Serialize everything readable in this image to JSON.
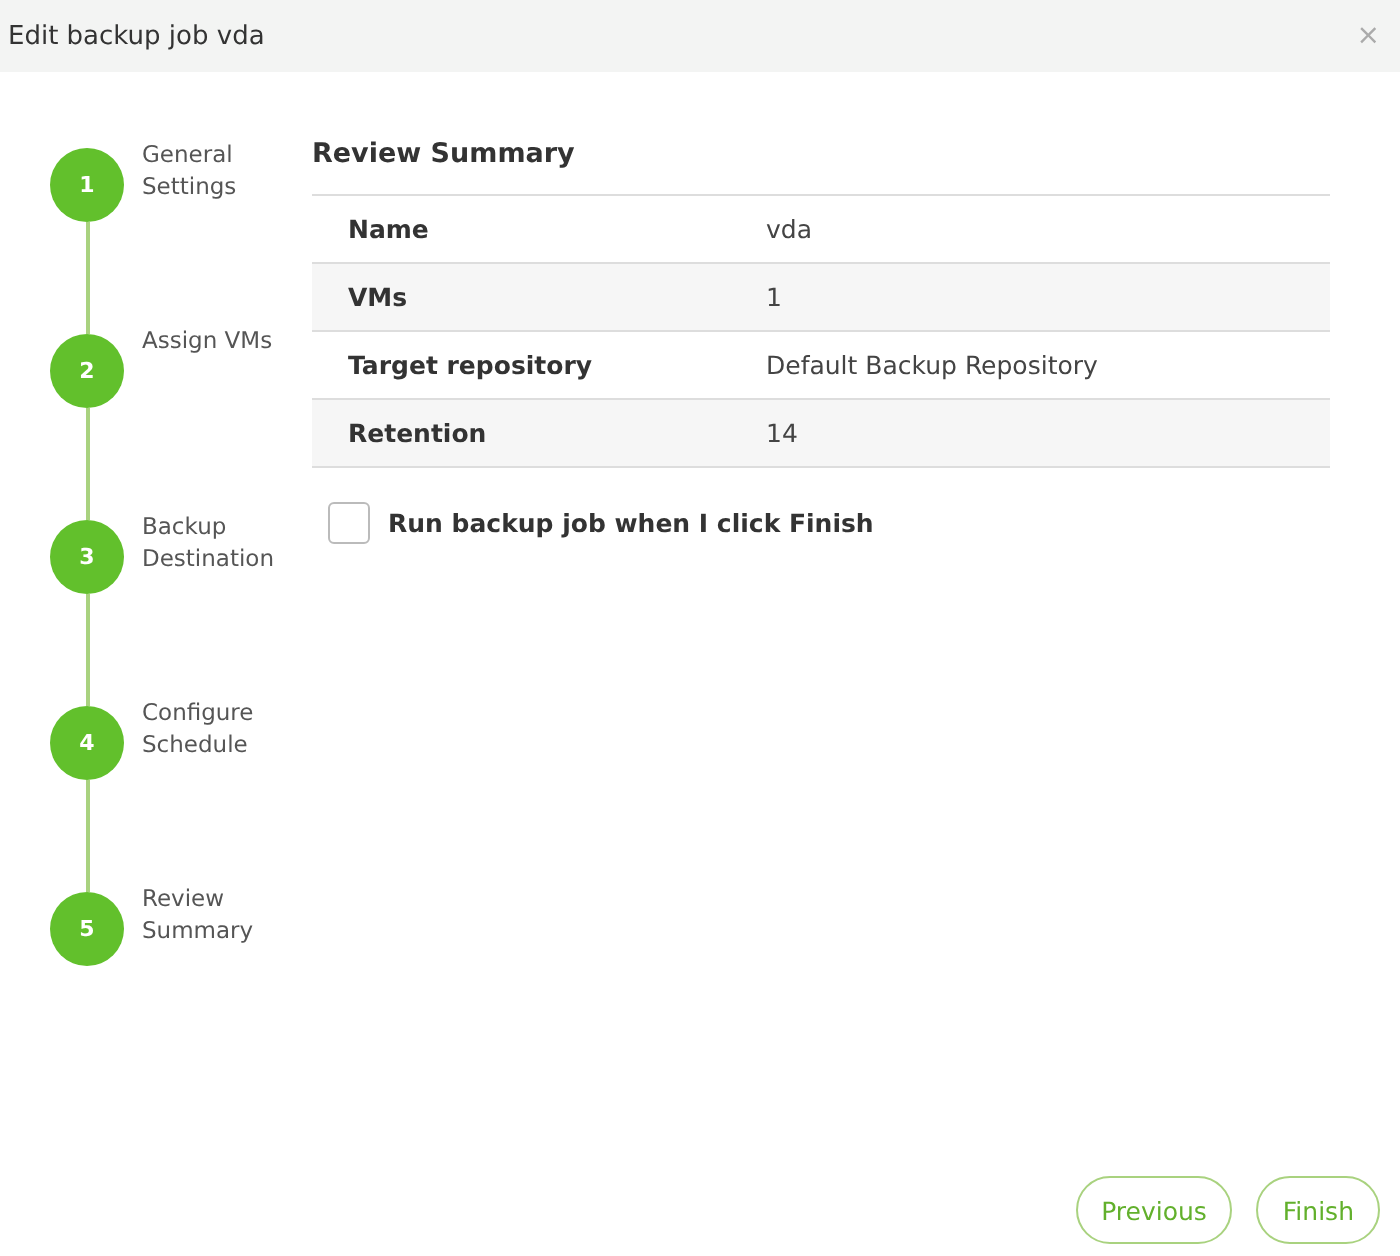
{
  "window": {
    "title": "Edit backup job vda",
    "close": "×"
  },
  "steps": [
    {
      "number": "1",
      "label": "General Settings"
    },
    {
      "number": "2",
      "label": "Assign VMs"
    },
    {
      "number": "3",
      "label": "Backup Destination"
    },
    {
      "number": "4",
      "label": "Configure Schedule"
    },
    {
      "number": "5",
      "label": "Review Summary"
    }
  ],
  "summary": {
    "title": "Review Summary",
    "rows": [
      {
        "label": "Name",
        "value": "vda"
      },
      {
        "label": "VMs",
        "value": "1"
      },
      {
        "label": "Target repository",
        "value": "Default Backup Repository"
      },
      {
        "label": "Retention",
        "value": "14"
      }
    ]
  },
  "run_option": {
    "label": "Run backup job when I click Finish",
    "checked": false
  },
  "buttons": [
    "Previous",
    "Finish"
  ]
}
